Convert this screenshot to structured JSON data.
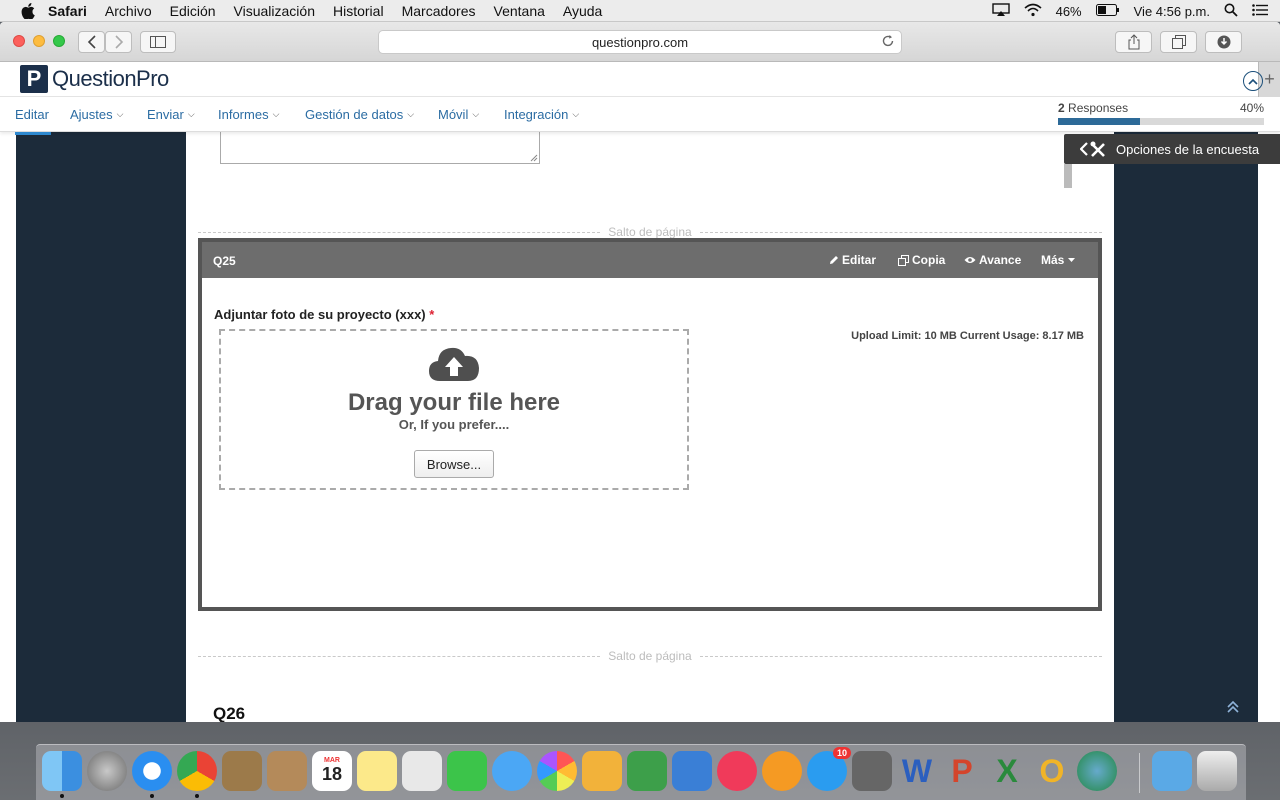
{
  "menubar": {
    "items": [
      "Safari",
      "Archivo",
      "Edición",
      "Visualización",
      "Historial",
      "Marcadores",
      "Ventana",
      "Ayuda"
    ],
    "battery": "46%",
    "clock": "Vie 4:56 p.m."
  },
  "browser": {
    "url": "questionpro.com",
    "new_tab": "+"
  },
  "app": {
    "logo_mark": "P",
    "logo_text": "QuestionPro"
  },
  "nav": {
    "tabs": [
      "Editar",
      "Ajustes",
      "Enviar",
      "Informes",
      "Gestión de datos",
      "Móvil",
      "Integración"
    ],
    "active": "Editar",
    "responses_count": "2",
    "responses_label": "Responses",
    "progress_label": "40%",
    "progress_value": 0.4,
    "progress_color": "#2d6a98"
  },
  "survey": {
    "page_break_label": "Salto de página",
    "options_label": "Opciones de la encuesta",
    "q25": {
      "number": "Q25",
      "actions": [
        "Editar",
        "Copia",
        "Avance",
        "Más"
      ],
      "title": "Adjuntar foto de su proyecto (xxx)",
      "required_mark": "*",
      "upload_limit": "Upload Limit: 10 MB Current Usage: 8.17 MB",
      "drag_text": "Drag your file here",
      "prefer_text": "Or, If you prefer....",
      "browse_label": "Browse..."
    },
    "q26": {
      "number": "Q26"
    }
  },
  "dock": {
    "calendar_month": "MAR",
    "calendar_day": "18",
    "appstore_badge": "10"
  }
}
